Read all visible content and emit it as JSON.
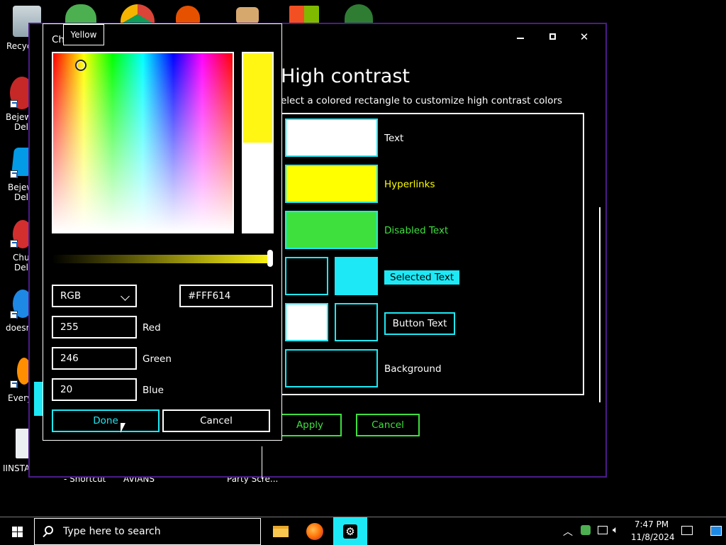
{
  "desktop": {
    "labels": {
      "recycle": "Recyc",
      "bej1a": "Bejew",
      "bej1b": "Delu",
      "bej2a": "Bejew",
      "bej2b": "Delu",
      "chu_a": "Chu",
      "chu_b": "Delu",
      "does": "doesn",
      "every": "Every",
      "install": "IINSTA",
      "shortcut": "- Shortcut",
      "avians": "AVIANS",
      "party": "Party Scre..."
    }
  },
  "settings": {
    "title": "High contrast",
    "subtitle": "elect a colored rectangle to customize high contrast colors",
    "rows": {
      "text": "Text",
      "hyperlinks": "Hyperlinks",
      "disabled": "Disabled Text",
      "selected": "Selected Text",
      "button": "Button Text",
      "background": "Background"
    },
    "apply": "Apply",
    "cancel": "Cancel",
    "colors": {
      "text": "#ffffff",
      "hyperlinks": "#ffff00",
      "disabled": "#3ee03e",
      "selected_bg": "#1de9f6",
      "accent_border": "#4b1b8a"
    }
  },
  "picker": {
    "title": "Ch          t color",
    "tooltip": "Yellow",
    "mode": "RGB",
    "hex": "#FFF614",
    "red_value": "255",
    "red_label": "Red",
    "green_value": "246",
    "green_label": "Green",
    "blue_value": "20",
    "blue_label": "Blue",
    "done": "Done",
    "cancel": "Cancel",
    "selected_color": "#fff614"
  },
  "taskbar": {
    "search_placeholder": "Type here to search",
    "time": "7:47 PM",
    "date": "11/8/2024"
  }
}
